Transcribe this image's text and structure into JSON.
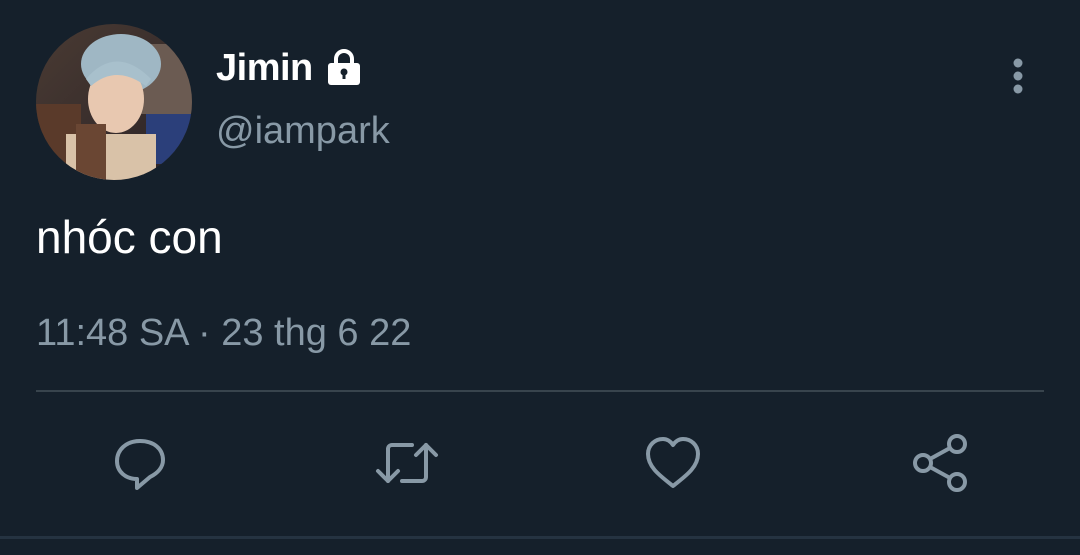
{
  "author": {
    "display_name": "Jimin",
    "handle": "@iampark",
    "protected": true
  },
  "tweet": {
    "text": "nhóc con",
    "timestamp": "11:48 SA · 23 thg 6 22"
  },
  "actions": [
    {
      "name": "reply",
      "icon": "reply-icon"
    },
    {
      "name": "retweet",
      "icon": "retweet-icon"
    },
    {
      "name": "like",
      "icon": "heart-icon"
    },
    {
      "name": "share",
      "icon": "share-icon"
    }
  ],
  "colors": {
    "background": "#15202b",
    "primary_text": "#ffffff",
    "secondary_text": "#8899a6",
    "divider": "#38444d"
  }
}
